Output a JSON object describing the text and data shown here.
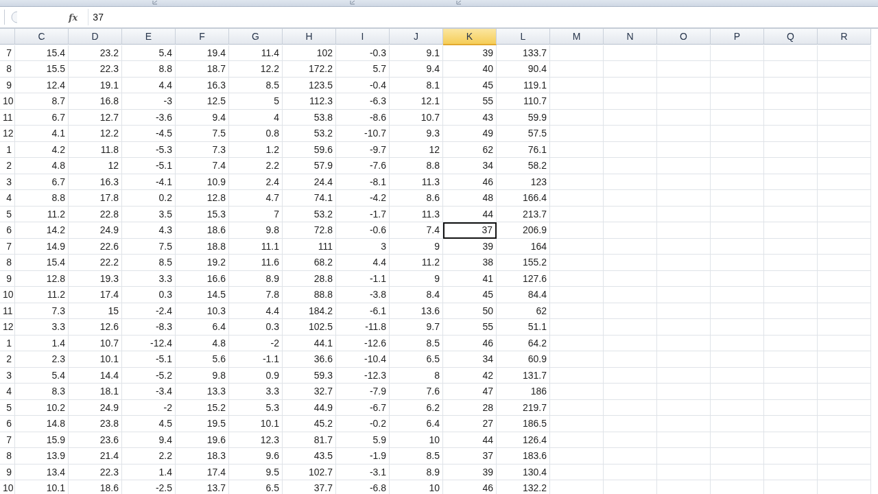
{
  "formula_bar": {
    "function_label": "fx",
    "value": "37"
  },
  "columns": [
    {
      "label": "C",
      "selected": false
    },
    {
      "label": "D",
      "selected": false
    },
    {
      "label": "E",
      "selected": false
    },
    {
      "label": "F",
      "selected": false
    },
    {
      "label": "G",
      "selected": false
    },
    {
      "label": "H",
      "selected": false
    },
    {
      "label": "I",
      "selected": false
    },
    {
      "label": "J",
      "selected": false
    },
    {
      "label": "K",
      "selected": true
    },
    {
      "label": "L",
      "selected": false
    },
    {
      "label": "M",
      "selected": false
    },
    {
      "label": "N",
      "selected": false
    },
    {
      "label": "O",
      "selected": false
    },
    {
      "label": "P",
      "selected": false
    },
    {
      "label": "Q",
      "selected": false
    },
    {
      "label": "R",
      "selected": false
    }
  ],
  "rows": [
    {
      "cells": [
        "7",
        "15.4",
        "23.2",
        "5.4",
        "19.4",
        "11.4",
        "102",
        "-0.3",
        "9.1",
        "39",
        "133.7"
      ],
      "selected": false
    },
    {
      "cells": [
        "8",
        "15.5",
        "22.3",
        "8.8",
        "18.7",
        "12.2",
        "172.2",
        "5.7",
        "9.4",
        "40",
        "90.4"
      ],
      "selected": false
    },
    {
      "cells": [
        "9",
        "12.4",
        "19.1",
        "4.4",
        "16.3",
        "8.5",
        "123.5",
        "-0.4",
        "8.1",
        "45",
        "119.1"
      ],
      "selected": false
    },
    {
      "cells": [
        "10",
        "8.7",
        "16.8",
        "-3",
        "12.5",
        "5",
        "112.3",
        "-6.3",
        "12.1",
        "55",
        "110.7"
      ],
      "selected": false
    },
    {
      "cells": [
        "11",
        "6.7",
        "12.7",
        "-3.6",
        "9.4",
        "4",
        "53.8",
        "-8.6",
        "10.7",
        "43",
        "59.9"
      ],
      "selected": false
    },
    {
      "cells": [
        "12",
        "4.1",
        "12.2",
        "-4.5",
        "7.5",
        "0.8",
        "53.2",
        "-10.7",
        "9.3",
        "49",
        "57.5"
      ],
      "selected": false
    },
    {
      "cells": [
        "1",
        "4.2",
        "11.8",
        "-5.3",
        "7.3",
        "1.2",
        "59.6",
        "-9.7",
        "12",
        "62",
        "76.1"
      ],
      "selected": false
    },
    {
      "cells": [
        "2",
        "4.8",
        "12",
        "-5.1",
        "7.4",
        "2.2",
        "57.9",
        "-7.6",
        "8.8",
        "34",
        "58.2"
      ],
      "selected": false
    },
    {
      "cells": [
        "3",
        "6.7",
        "16.3",
        "-4.1",
        "10.9",
        "2.4",
        "24.4",
        "-8.1",
        "11.3",
        "46",
        "123"
      ],
      "selected": false
    },
    {
      "cells": [
        "4",
        "8.8",
        "17.8",
        "0.2",
        "12.8",
        "4.7",
        "74.1",
        "-4.2",
        "8.6",
        "48",
        "166.4"
      ],
      "selected": false
    },
    {
      "cells": [
        "5",
        "11.2",
        "22.8",
        "3.5",
        "15.3",
        "7",
        "53.2",
        "-1.7",
        "11.3",
        "44",
        "213.7"
      ],
      "selected": false
    },
    {
      "cells": [
        "6",
        "14.2",
        "24.9",
        "4.3",
        "18.6",
        "9.8",
        "72.8",
        "-0.6",
        "7.4",
        "37",
        "206.9"
      ],
      "selected": true
    },
    {
      "cells": [
        "7",
        "14.9",
        "22.6",
        "7.5",
        "18.8",
        "11.1",
        "111",
        "3",
        "9",
        "39",
        "164"
      ],
      "selected": false
    },
    {
      "cells": [
        "8",
        "15.4",
        "22.2",
        "8.5",
        "19.2",
        "11.6",
        "68.2",
        "4.4",
        "11.2",
        "38",
        "155.2"
      ],
      "selected": false
    },
    {
      "cells": [
        "9",
        "12.8",
        "19.3",
        "3.3",
        "16.6",
        "8.9",
        "28.8",
        "-1.1",
        "9",
        "41",
        "127.6"
      ],
      "selected": false
    },
    {
      "cells": [
        "10",
        "11.2",
        "17.4",
        "0.3",
        "14.5",
        "7.8",
        "88.8",
        "-3.8",
        "8.4",
        "45",
        "84.4"
      ],
      "selected": false
    },
    {
      "cells": [
        "11",
        "7.3",
        "15",
        "-2.4",
        "10.3",
        "4.4",
        "184.2",
        "-6.1",
        "13.6",
        "50",
        "62"
      ],
      "selected": false
    },
    {
      "cells": [
        "12",
        "3.3",
        "12.6",
        "-8.3",
        "6.4",
        "0.3",
        "102.5",
        "-11.8",
        "9.7",
        "55",
        "51.1"
      ],
      "selected": false
    },
    {
      "cells": [
        "1",
        "1.4",
        "10.7",
        "-12.4",
        "4.8",
        "-2",
        "44.1",
        "-12.6",
        "8.5",
        "46",
        "64.2"
      ],
      "selected": false
    },
    {
      "cells": [
        "2",
        "2.3",
        "10.1",
        "-5.1",
        "5.6",
        "-1.1",
        "36.6",
        "-10.4",
        "6.5",
        "34",
        "60.9"
      ],
      "selected": false
    },
    {
      "cells": [
        "3",
        "5.4",
        "14.4",
        "-5.2",
        "9.8",
        "0.9",
        "59.3",
        "-12.3",
        "8",
        "42",
        "131.7"
      ],
      "selected": false
    },
    {
      "cells": [
        "4",
        "8.3",
        "18.1",
        "-3.4",
        "13.3",
        "3.3",
        "32.7",
        "-7.9",
        "7.6",
        "47",
        "186"
      ],
      "selected": false
    },
    {
      "cells": [
        "5",
        "10.2",
        "24.9",
        "-2",
        "15.2",
        "5.3",
        "44.9",
        "-6.7",
        "6.2",
        "28",
        "219.7"
      ],
      "selected": false
    },
    {
      "cells": [
        "6",
        "14.8",
        "23.8",
        "4.5",
        "19.5",
        "10.1",
        "45.2",
        "-0.2",
        "6.4",
        "27",
        "186.5"
      ],
      "selected": false
    },
    {
      "cells": [
        "7",
        "15.9",
        "23.6",
        "9.4",
        "19.6",
        "12.3",
        "81.7",
        "5.9",
        "10",
        "44",
        "126.4"
      ],
      "selected": false
    },
    {
      "cells": [
        "8",
        "13.9",
        "21.4",
        "2.2",
        "18.3",
        "9.6",
        "43.5",
        "-1.9",
        "8.5",
        "37",
        "183.6"
      ],
      "selected": false
    },
    {
      "cells": [
        "9",
        "13.4",
        "22.3",
        "1.4",
        "17.4",
        "9.5",
        "102.7",
        "-3.1",
        "8.9",
        "39",
        "130.4"
      ],
      "selected": false
    },
    {
      "cells": [
        "10",
        "10.1",
        "18.6",
        "-2.5",
        "13.7",
        "6.5",
        "37.7",
        "-6.8",
        "10",
        "46",
        "132.2"
      ],
      "selected": false
    }
  ]
}
